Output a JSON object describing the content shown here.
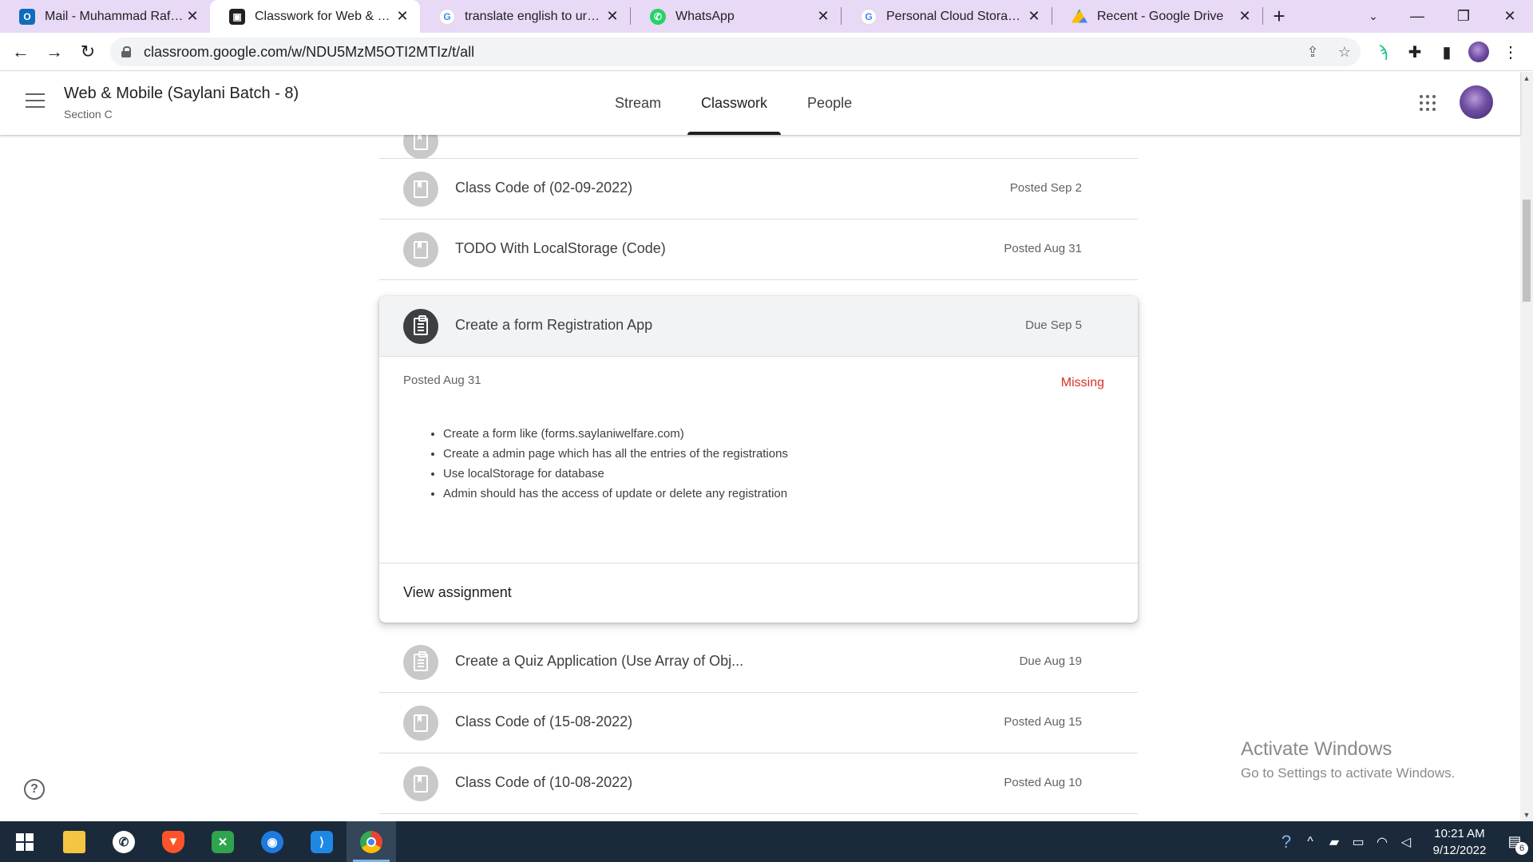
{
  "browser": {
    "tabs": [
      {
        "title": "Mail - Muhammad Rafay - C",
        "favicon": "outlook-icon",
        "color": "#0f6cbd",
        "active": false
      },
      {
        "title": "Classwork for Web & Mobil",
        "favicon": "classroom-icon",
        "color": "#202124",
        "active": true
      },
      {
        "title": "translate english to urdu - C",
        "favicon": "google-icon",
        "color": "#4285f4",
        "active": false
      },
      {
        "title": "WhatsApp",
        "favicon": "whatsapp-icon",
        "color": "#25d366",
        "active": false
      },
      {
        "title": "Personal Cloud Storage & F",
        "favicon": "google-icon",
        "color": "#4285f4",
        "active": false
      },
      {
        "title": "Recent - Google Drive",
        "favicon": "drive-icon",
        "color": "#fbbc04",
        "active": false
      }
    ],
    "new_tab": "+",
    "url": "classroom.google.com/w/NDU5MzM5OTI2MTIz/t/all"
  },
  "course": {
    "title": "Web & Mobile (Saylani Batch - 8)",
    "section": "Section C",
    "nav": [
      "Stream",
      "Classwork",
      "People"
    ],
    "active_nav": "Classwork"
  },
  "items_before": [
    {
      "title": "Class Code of (02-09-2022)",
      "meta": "Posted Sep 2",
      "type": "material"
    },
    {
      "title": "TODO With LocalStorage (Code)",
      "meta": "Posted Aug 31",
      "type": "material"
    }
  ],
  "expanded": {
    "title": "Create a form Registration App",
    "due": "Due Sep 5",
    "posted": "Posted Aug 31",
    "status": "Missing",
    "status_color": "#d93025",
    "instructions": [
      "Create a form like (forms.saylaniwelfare.com)",
      "Create a admin page which has all the entries of the registrations",
      "Use localStorage for database",
      "Admin should has the access of update or delete any registration"
    ],
    "view_link": "View assignment"
  },
  "items_after": [
    {
      "title": "Create a Quiz Application (Use Array of Obj...",
      "meta": "Due Aug 19",
      "type": "assignment"
    },
    {
      "title": "Class Code of (15-08-2022)",
      "meta": "Posted Aug 15",
      "type": "material"
    },
    {
      "title": "Class Code of (10-08-2022)",
      "meta": "Posted Aug 10",
      "type": "material"
    }
  ],
  "watermark": {
    "line1": "Activate Windows",
    "line2": "Go to Settings to activate Windows."
  },
  "taskbar": {
    "time": "10:21 AM",
    "date": "9/12/2022",
    "notifications": "6"
  }
}
